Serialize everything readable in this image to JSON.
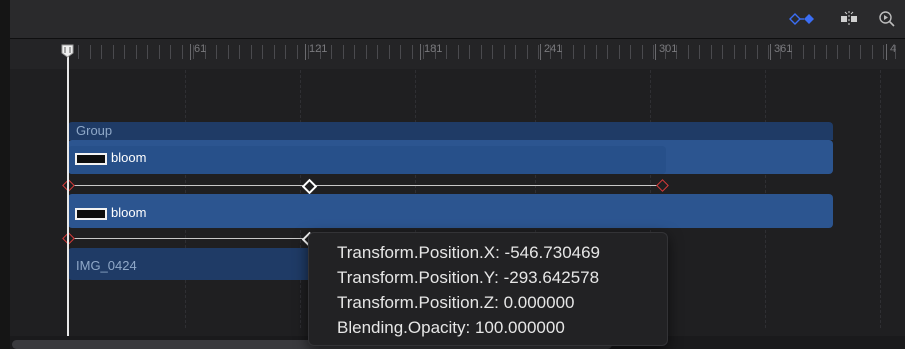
{
  "toolbar": {
    "keyframe_nav_icon": "keyframe-navigation-icon",
    "snapping_icon": "snapping-icon",
    "zoom_icon": "zoom-icon",
    "accent": "#3b6ef5"
  },
  "ruler": {
    "labels": [
      "61",
      "121",
      "181",
      "241",
      "301",
      "361",
      "4"
    ]
  },
  "timeline": {
    "group_label": "Group",
    "layers": [
      {
        "label": "bloom"
      },
      {
        "label": "bloom"
      }
    ],
    "image_layer_label": "IMG_0424"
  },
  "tooltip": {
    "lines": [
      "Transform.Position.X: -546.730469",
      "Transform.Position.Y: -293.642578",
      "Transform.Position.Z: 0.000000",
      "Blending.Opacity: 100.000000"
    ]
  }
}
